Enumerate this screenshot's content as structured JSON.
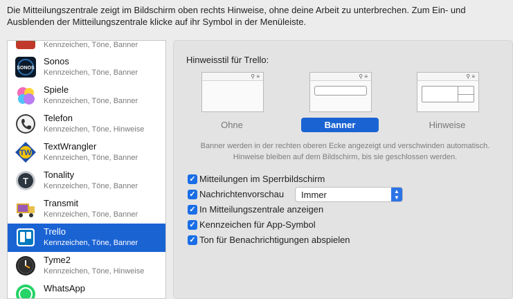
{
  "intro_text": "Die Mitteilungszentrale zeigt im Bildschirm oben rechts Hinweise, ohne deine Arbeit zu unterbrechen. Zum Ein- und Ausblenden der Mitteilungszentrale klicke auf ihr Symbol in der Menüleiste.",
  "apps": [
    {
      "name": "",
      "sub": "Kennzeichen, Töne, Banner",
      "icon": "app-icon"
    },
    {
      "name": "Sonos",
      "sub": "Kennzeichen, Töne, Banner",
      "icon": "sonos-icon"
    },
    {
      "name": "Spiele",
      "sub": "Kennzeichen, Töne, Banner",
      "icon": "game-center-icon"
    },
    {
      "name": "Telefon",
      "sub": "Kennzeichen, Töne, Hinweise",
      "icon": "phone-icon"
    },
    {
      "name": "TextWrangler",
      "sub": "Kennzeichen, Töne, Banner",
      "icon": "textwrangler-icon"
    },
    {
      "name": "Tonality",
      "sub": "Kennzeichen, Töne, Banner",
      "icon": "tonality-icon"
    },
    {
      "name": "Transmit",
      "sub": "Kennzeichen, Töne, Banner",
      "icon": "transmit-truck-icon"
    },
    {
      "name": "Trello",
      "sub": "Kennzeichen, Töne, Banner",
      "icon": "trello-icon",
      "selected": true
    },
    {
      "name": "Tyme2",
      "sub": "Kennzeichen, Töne, Hinweise",
      "icon": "clock-icon"
    },
    {
      "name": "WhatsApp",
      "sub": "",
      "icon": "whatsapp-icon"
    }
  ],
  "panel": {
    "title": "Hinweisstil für Trello:",
    "styles": [
      "Ohne",
      "Banner",
      "Hinweise"
    ],
    "selected_style": "Banner",
    "description": "Banner werden in der rechten oberen Ecke angezeigt und verschwinden automatisch. Hinweise bleiben auf dem Bildschirm, bis sie geschlossen werden.",
    "options": [
      {
        "label": "Mitteilungen im Sperrbildschirm",
        "checked": true
      },
      {
        "label": "Nachrichtenvorschau",
        "checked": true
      },
      {
        "label": "In Mitteilungszentrale anzeigen",
        "checked": true
      },
      {
        "label": "Kennzeichen für App-Symbol",
        "checked": true
      },
      {
        "label": "Ton für Benachrichtigungen abspielen",
        "checked": true
      }
    ],
    "preview_select": {
      "value": "Immer"
    }
  },
  "colors": {
    "accent": "#1a63d3",
    "checkbox": "#1a6ee6"
  }
}
